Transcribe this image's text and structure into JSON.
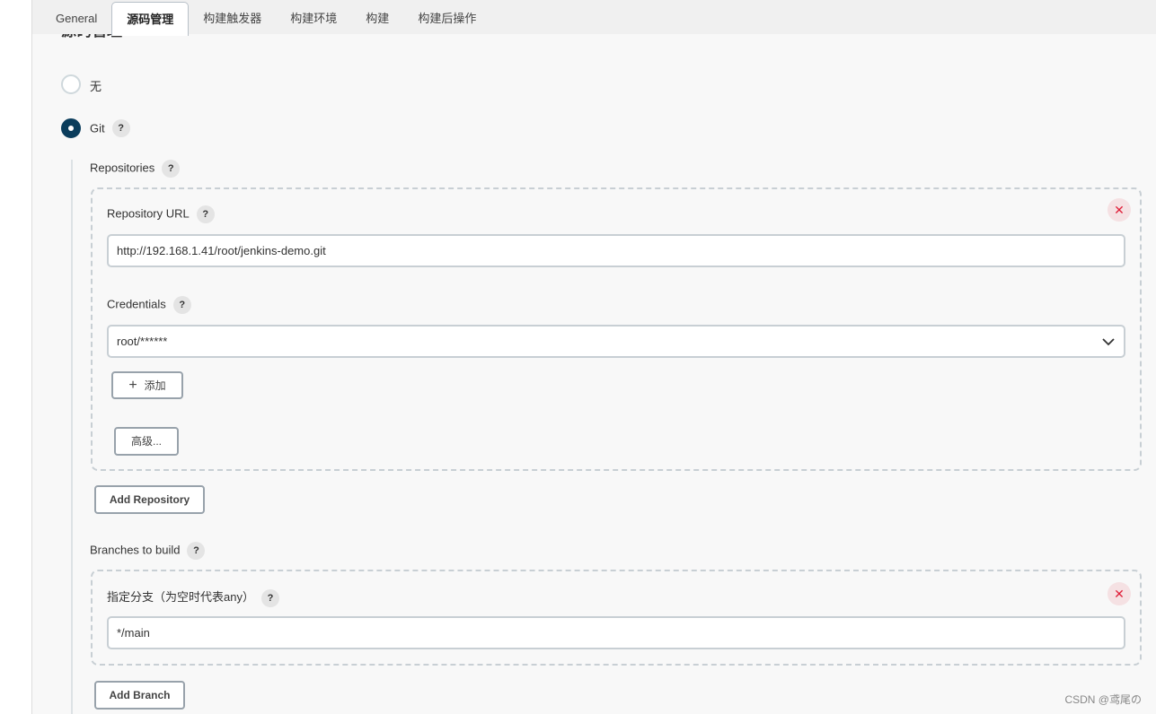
{
  "tabs": [
    {
      "label": "General"
    },
    {
      "label": "源码管理",
      "active": true
    },
    {
      "label": "构建触发器"
    },
    {
      "label": "构建环境"
    },
    {
      "label": "构建"
    },
    {
      "label": "构建后操作"
    }
  ],
  "section_title": "源码管理",
  "scm_options": [
    {
      "label": "无",
      "selected": false
    },
    {
      "label": "Git",
      "selected": true
    }
  ],
  "repositories": {
    "label": "Repositories",
    "url_label": "Repository URL",
    "url_value": "http://192.168.1.41/root/jenkins-demo.git",
    "credentials_label": "Credentials",
    "credentials_value": "root/******",
    "add_label": "添加",
    "advanced_label": "高级...",
    "add_repository_label": "Add Repository"
  },
  "branches": {
    "label": "Branches to build",
    "spec_label": "指定分支（为空时代表any）",
    "spec_value": "*/main",
    "add_branch_label": "Add Branch"
  },
  "help_glyph": "?",
  "delete_glyph": "✕",
  "plus_glyph": "+",
  "watermark": "CSDN @鸢尾の",
  "colors": {
    "radio_selected": "#0b3d5c",
    "delete": "#e0203a"
  }
}
